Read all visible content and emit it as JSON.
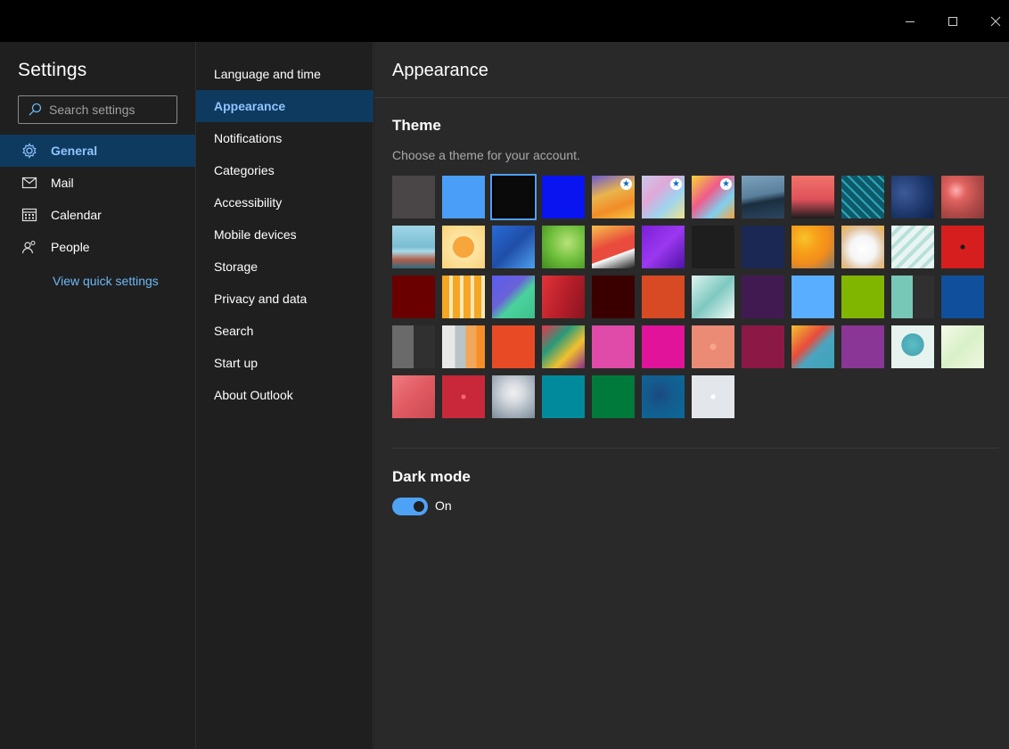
{
  "window": {
    "minimize_label": "",
    "maximize_label": "",
    "close_label": ""
  },
  "leftnav": {
    "title": "Settings",
    "search_placeholder": "Search settings",
    "items": [
      {
        "label": "General",
        "icon": "gear-icon",
        "selected": true
      },
      {
        "label": "Mail",
        "icon": "mail-icon",
        "selected": false
      },
      {
        "label": "Calendar",
        "icon": "calendar-icon",
        "selected": false
      },
      {
        "label": "People",
        "icon": "people-icon",
        "selected": false
      }
    ],
    "quick_settings_link": "View quick settings"
  },
  "midnav": {
    "items": [
      {
        "label": "Language and time",
        "selected": false
      },
      {
        "label": "Appearance",
        "selected": true
      },
      {
        "label": "Notifications",
        "selected": false
      },
      {
        "label": "Categories",
        "selected": false
      },
      {
        "label": "Accessibility",
        "selected": false
      },
      {
        "label": "Mobile devices",
        "selected": false
      },
      {
        "label": "Storage",
        "selected": false
      },
      {
        "label": "Privacy and data",
        "selected": false
      },
      {
        "label": "Search",
        "selected": false
      },
      {
        "label": "Start up",
        "selected": false
      },
      {
        "label": "About Outlook",
        "selected": false
      }
    ]
  },
  "main": {
    "title": "Appearance",
    "theme": {
      "heading": "Theme",
      "subtitle": "Choose a theme for your account.",
      "selected_index": 2,
      "swatches": [
        {
          "bg": "#4a4546"
        },
        {
          "bg": "#4a9ef7"
        },
        {
          "bg": "#0a0a0a"
        },
        {
          "bg": "#0a14f0"
        },
        {
          "bg": "linear-gradient(160deg,#6a5ad0 0%,#e9b44c 40%,#f28c28 70%,#f5c542 100%)",
          "badge": true
        },
        {
          "bg": "linear-gradient(135deg,#c9c9e8 0%,#e0a8d8 35%,#9fd4f0 65%,#f0e38a 100%)",
          "badge": true
        },
        {
          "bg": "linear-gradient(135deg,#f7d436 0%,#ef5b8a 40%,#7fd0f0 70%,#f8a43b 100%)",
          "badge": true
        },
        {
          "bg": "linear-gradient(170deg,#7da2bd 0%,#5a7f9c 45%,#1b2e3f 60%,#2c4660 100%)"
        },
        {
          "bg": "linear-gradient(180deg,#f0726a 0%,#e0515a 55%,#1c1c1c 100%)"
        },
        {
          "bg": "repeating-linear-gradient(45deg,#0d5a6b 0 6px,#2fa6b8 6px 8px)"
        },
        {
          "bg": "radial-gradient(circle at 30% 40%,#3d5a99 0%,#1c3568 60%,#0f2147 100%)"
        },
        {
          "bg": "radial-gradient(circle at 35% 35%,#ffb0b0 0%,#e0625f 25%,#b04a48 60%,#8a3a3a 100%)"
        },
        {
          "bg": "linear-gradient(180deg,#9fd6e6 0%,#7bbdd3 50%,#a9dbe9 60%,#b05e4a 80%,#2e6a7e 100%)"
        },
        {
          "bg": "radial-gradient(circle at 50% 50%,#f6a63a 0%,#f6a63a 35%,#fde5a3 36%,#fbd27a 100%)"
        },
        {
          "bg": "linear-gradient(135deg,#2a6ad6 0%,#1f4ea8 50%,#4fa0f0 100%)"
        },
        {
          "bg": "radial-gradient(circle at 60% 40%,#b8e27a 0%,#6fbf3c 50%,#3f8a1e 100%)"
        },
        {
          "bg": "linear-gradient(160deg,#f5c04a 0%,#e94b3c 45%,#e94b3c 65%,#ffffff 66%,#1e1e1e 100%)"
        },
        {
          "bg": "linear-gradient(135deg,#7a1fd6 0%,#9b38f0 50%,#4f12a6 100%)"
        },
        {
          "bg": "#1e1e1e"
        },
        {
          "bg": "#1c2854"
        },
        {
          "bg": "radial-gradient(circle at 30% 30%,#f7c42a 0%,#f7a11a 30%,#f28c1b 60%,#7a7a7a 100%)"
        },
        {
          "bg": "radial-gradient(circle at 50% 55%,#ffffff 0%,#f5f5f5 40%,#e0c09a 70%,#f0b040 100%)"
        },
        {
          "bg": "repeating-linear-gradient(135deg,#e8f5f2 0 6px,#b8e0d8 6px 10px)"
        },
        {
          "bg": "radial-gradient(circle,#1a1a1a 2px,#d61e1e 3px)"
        },
        {
          "bg": "#6b0000"
        },
        {
          "bg": "repeating-linear-gradient(90deg,#f5a623 0 8px,#fce7b6 8px 12px)"
        },
        {
          "bg": "linear-gradient(135deg,#5b5bf0 0%,#6a62d8 40%,#4ad39c 60%,#3fbf8c 100%)"
        },
        {
          "bg": "linear-gradient(110deg,#e0343a 0%,#b81f2a 50%,#8a1520 100%)"
        },
        {
          "bg": "#3a0000"
        },
        {
          "bg": "#d84a23"
        },
        {
          "bg": "linear-gradient(135deg,#dff3f0 0%,#7ec8c0 50%,#f0faf8 100%)"
        },
        {
          "bg": "#421a52"
        },
        {
          "bg": "#5aaeff"
        },
        {
          "bg": "#80b600"
        },
        {
          "bg": "linear-gradient(90deg,#77c8b6 0%,#77c8b6 50%,#303030 50%,#303030 100%)"
        },
        {
          "bg": "#0f4f9c"
        },
        {
          "bg": "linear-gradient(90deg,#6a6a6a 0%,#6a6a6a 50%,#303030 50%,#303030 100%)"
        },
        {
          "bg": "linear-gradient(90deg,#e8e8e8 0%,#e8e8e8 30%,#b8c4c8 30%,#b8c4c8 55%,#f2a65a 55%,#f2a65a 80%,#f58e26 80%)"
        },
        {
          "bg": "#e84a26"
        },
        {
          "bg": "linear-gradient(135deg,#e8344a 0%,#2a9a7a 35%,#f2c12e 65%,#8a2a8a 100%)"
        },
        {
          "bg": "#e04aa8"
        },
        {
          "bg": "#e0139a"
        },
        {
          "bg": "radial-gradient(circle,#f7a58e 3px,#eb8b76 4px)"
        },
        {
          "bg": "#8c1846"
        },
        {
          "bg": "linear-gradient(135deg,#f2c12e 0%,#e94b3c 40%,#4aa5c0 60%,#3fa3b8 100%)"
        },
        {
          "bg": "#8a3696"
        },
        {
          "bg": "radial-gradient(circle at 50% 45%,#5bbec8 0%,#4aa8b4 35%,#e6f3ee 36%,#e6f3ee 100%)"
        },
        {
          "bg": "linear-gradient(135deg,#f5fae8 0%,#d8f0c8 50%,#f0f8e0 100%)"
        },
        {
          "bg": "linear-gradient(135deg,#f07a80 0%,#e05a62 50%,#cc4a52 100%)"
        },
        {
          "bg": "radial-gradient(circle,#f46a6a 2px,#c8283a 3px)"
        },
        {
          "bg": "radial-gradient(circle at 50% 40%,#f0f0f0 0%,#d6dae0 30%,#7a8a9a 100%)"
        },
        {
          "bg": "#008a9c"
        },
        {
          "bg": "#007a3a"
        },
        {
          "bg": "radial-gradient(circle at 40% 45%,#1a4a80 0%,#145b8e 40%,#0a6a9a 100%)"
        },
        {
          "bg": "radial-gradient(circle,#ffffff 2px,#e3e7ec 3px)"
        }
      ]
    },
    "dark_mode": {
      "heading": "Dark mode",
      "state_label": "On",
      "on": true
    }
  }
}
